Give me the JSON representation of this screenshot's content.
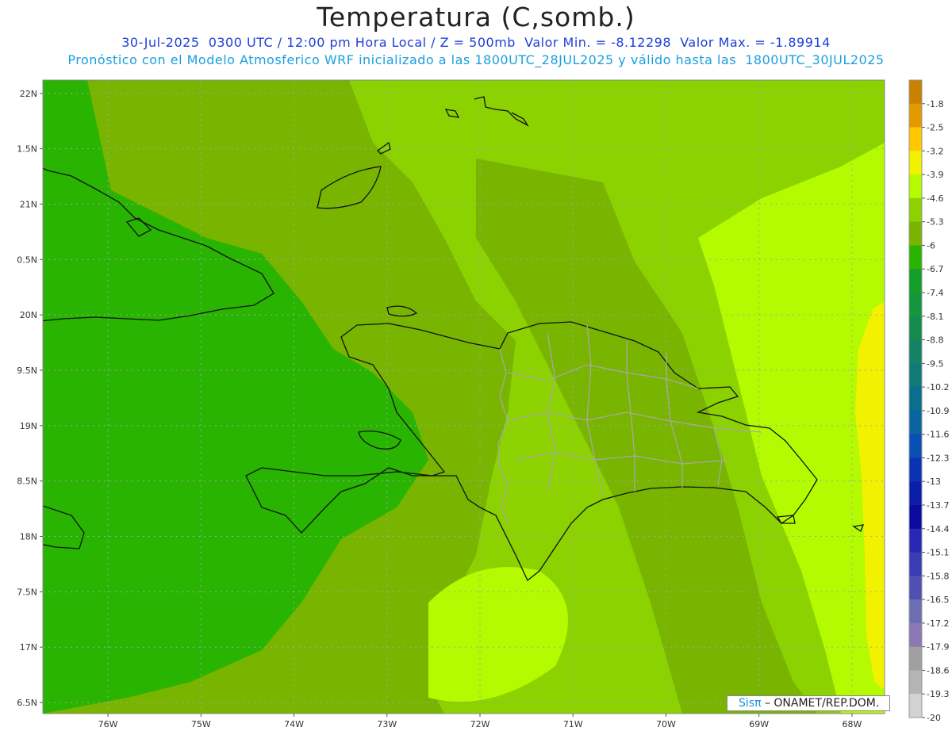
{
  "header": {
    "title": "Temperatura (C,somb.)",
    "line1": "30-Jul-2025  0300 UTC / 12:00 pm Hora Local / Z = 500mb  Valor Min. = -8.12298  Valor Max. = -1.89914",
    "line2": "Pronóstico con el Modelo Atmosferico WRF inicializado a las 1800UTC_28JUL2025 y válido hasta las  1800UTC_30JUL2025"
  },
  "map": {
    "lat_labels": [
      "22N",
      "1.5N",
      "21N",
      "0.5N",
      "20N",
      "9.5N",
      "19N",
      "8.5N",
      "18N",
      "7.5N",
      "17N",
      "6.5N"
    ],
    "lon_labels": [
      "76W",
      "75W",
      "74W",
      "73W",
      "72W",
      "71W",
      "70W",
      "69W",
      "68W"
    ],
    "lon_range": [
      -76.7,
      -67.65
    ],
    "lat_range": [
      16.4,
      22.12
    ],
    "grid": "dotted"
  },
  "colorbar": {
    "labels": [
      "-1.8",
      "-2.5",
      "-3.2",
      "-3.9",
      "-4.6",
      "-5.3",
      "-6",
      "-6.7",
      "-7.4",
      "-8.1",
      "-8.8",
      "-9.5",
      "-10.2",
      "-10.9",
      "-11.6",
      "-12.3",
      "-13",
      "-13.7",
      "-14.4",
      "-15.1",
      "-15.8",
      "-16.5",
      "-17.2",
      "-17.9",
      "-18.6",
      "-19.3",
      "-20"
    ],
    "colors": [
      "#c88200",
      "#e29a00",
      "#ffc800",
      "#f2f200",
      "#b4fa00",
      "#8cd200",
      "#78b400",
      "#28b400",
      "#14a028",
      "#14963c",
      "#148c50",
      "#148264",
      "#107a78",
      "#0a6e8c",
      "#0a64a0",
      "#0a50b4",
      "#0a32b4",
      "#0a1eaa",
      "#0a0aa0",
      "#2828b4",
      "#3c3cb4",
      "#5050b4",
      "#6e6eb4",
      "#8c78b4",
      "#a0a0a0",
      "#b4b4b4",
      "#d2d2d2"
    ]
  },
  "credit": {
    "sis": "Sisπ",
    "rest": "– ONAMET/REP.DOM."
  }
}
